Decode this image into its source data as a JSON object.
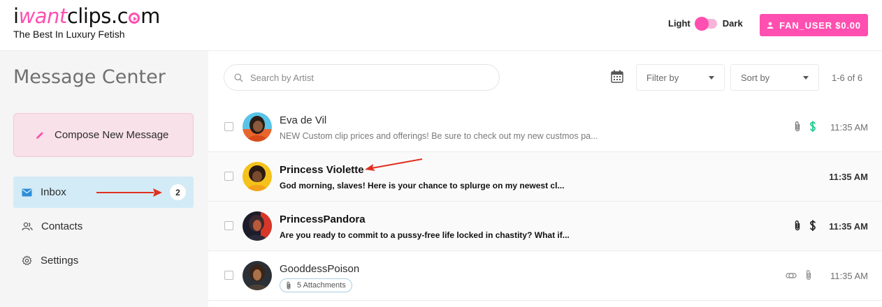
{
  "header": {
    "logo_prefix": "i",
    "logo_want": "want",
    "logo_clips": "clips.c",
    "logo_suffix": "m",
    "tagline": "The Best In Luxury Fetish",
    "theme_light": "Light",
    "theme_dark": "Dark",
    "user_button": "FAN_USER $0.00"
  },
  "sidebar": {
    "title": "Message Center",
    "compose_label": "Compose New Message",
    "items": [
      {
        "label": "Inbox",
        "badge": "2",
        "active": true
      },
      {
        "label": "Contacts"
      },
      {
        "label": "Settings"
      }
    ]
  },
  "toolbar": {
    "search_placeholder": "Search by Artist",
    "filter_label": "Filter by",
    "sort_label": "Sort by",
    "range_label": "1-6 of 6"
  },
  "messages": [
    {
      "sender": "Eva de Vil",
      "preview": "NEW Custom clip prices and offerings! Be sure to check out my new custmos pa...",
      "time": "11:35 AM",
      "unread": false,
      "icons": [
        "paperclip-icon",
        "dollar-icon"
      ]
    },
    {
      "sender": "Princess Violette",
      "preview": "God morning, slaves! Here is your chance to splurge on my newest cl...",
      "time": "11:35 AM",
      "unread": true,
      "icons": []
    },
    {
      "sender": "PrincessPandora",
      "preview": "Are you ready to commit to a pussy-free life locked in chastity? What if...",
      "time": "11:35 AM",
      "unread": true,
      "icons": [
        "paperclip-icon",
        "dollar-icon"
      ]
    },
    {
      "sender": "GooddessPoison",
      "attachments": "5 Attachments",
      "time": "11:35 AM",
      "unread": false,
      "icons": [
        "link-icon",
        "paperclip-icon"
      ]
    }
  ],
  "colors": {
    "brand_pink": "#ff4fb0",
    "active_nav": "#d3ebf6",
    "compose_bg": "#f8e1e8",
    "dollar_green": "#1ec98b",
    "annotation_red": "#e0301e"
  }
}
